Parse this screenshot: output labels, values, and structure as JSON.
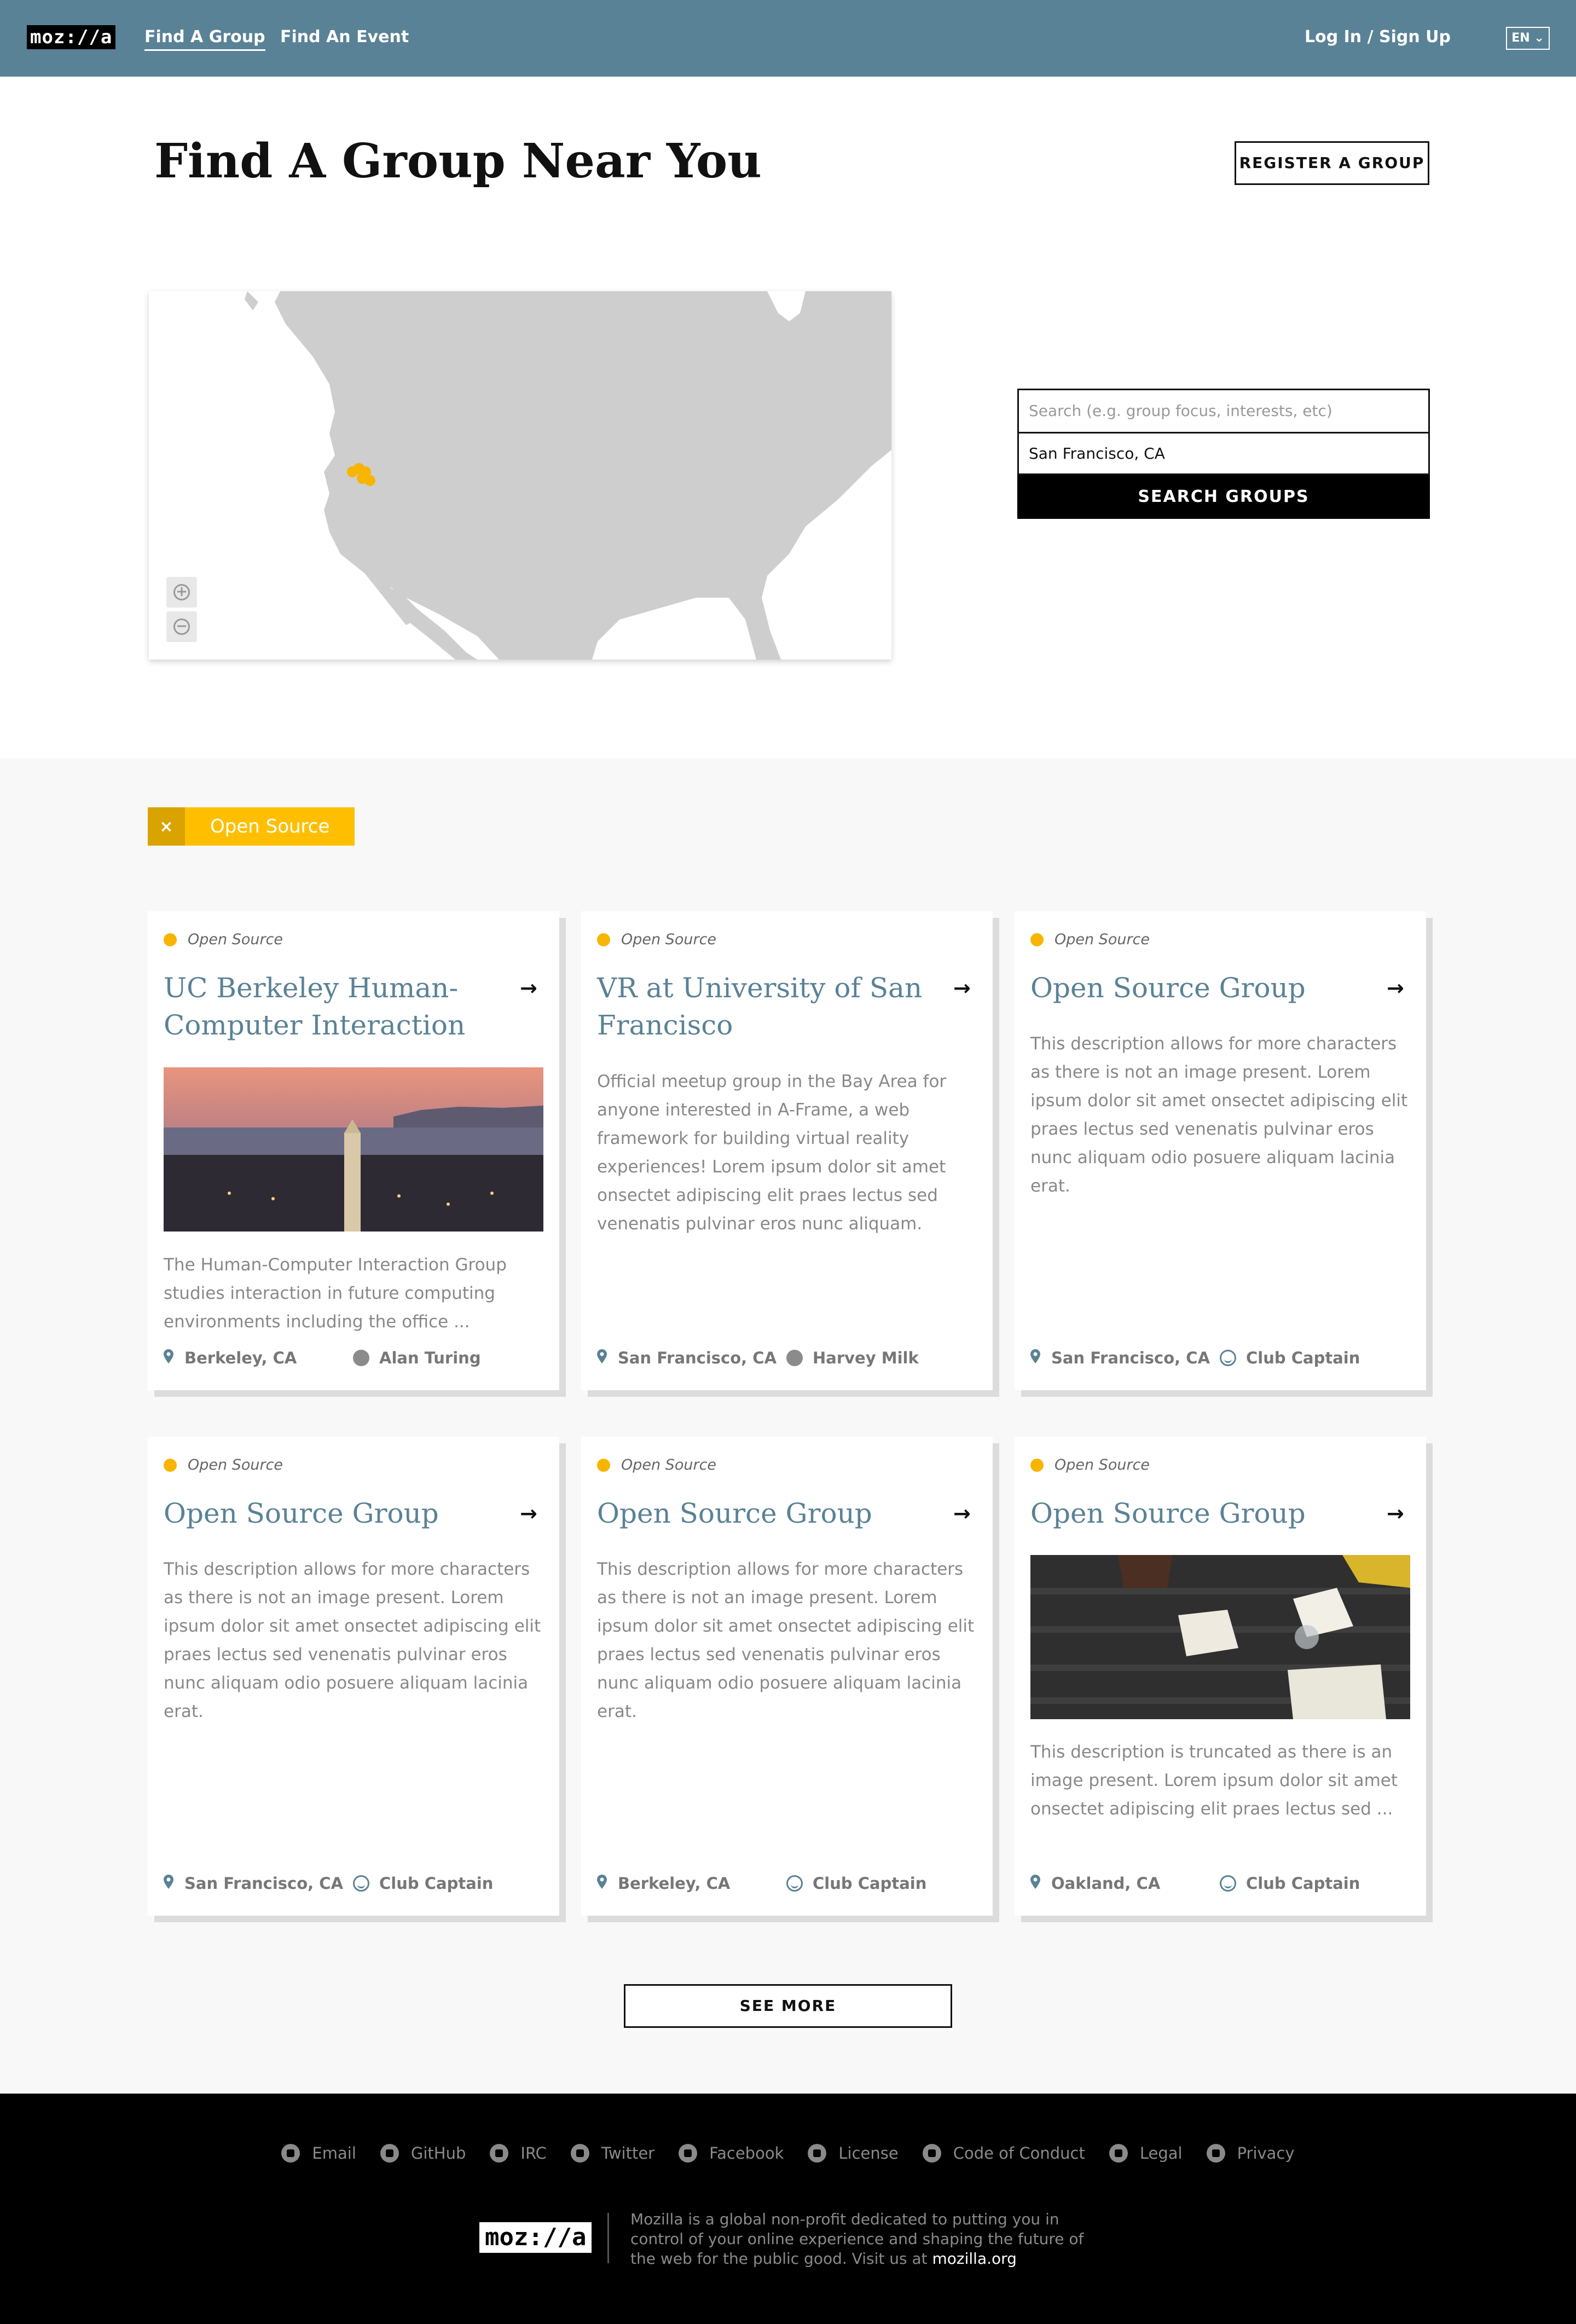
{
  "header": {
    "logo": "moz://a",
    "nav": [
      {
        "label": "Find A Group",
        "active": true
      },
      {
        "label": "Find An Event",
        "active": false
      }
    ],
    "login": "Log In / Sign Up",
    "lang": "EN"
  },
  "hero": {
    "title": "Find A Group Near You",
    "register_label": "REGISTER A GROUP"
  },
  "search": {
    "placeholder": "Search (e.g. group focus, interests, etc)",
    "location": "San Francisco, CA",
    "button": "SEARCH GROUPS"
  },
  "filter": {
    "label": "Open Source",
    "remove": "×"
  },
  "cards": [
    {
      "tag": "Open Source",
      "title": "UC Berkeley Human-Computer Interaction",
      "description": "The Human-Computer Interaction Group studies interaction in future computing environments including the office ...",
      "location": "Berkeley, CA",
      "user": "Alan Turing",
      "has_image": true
    },
    {
      "tag": "Open Source",
      "title": "VR at University of San Francisco",
      "description": "Official meetup group in the Bay Area for anyone interested in A-Frame, a web framework for building virtual reality experiences! Lorem ipsum dolor sit amet onsectet adipiscing elit praes lectus sed venenatis pulvinar eros nunc aliquam.",
      "location": "San Francisco, CA",
      "user": "Harvey Milk",
      "has_image": false
    },
    {
      "tag": "Open Source",
      "title": "Open Source Group",
      "description": "This description allows for more characters as there is not an image present. Lorem ipsum dolor sit amet onsectet adipiscing elit praes lectus sed venenatis pulvinar eros nunc aliquam odio posuere aliquam lacinia erat.",
      "location": "San Francisco, CA",
      "user": "Club Captain",
      "has_image": false
    },
    {
      "tag": "Open Source",
      "title": "Open Source Group",
      "description": "This description allows for more characters as there is not an image present. Lorem ipsum dolor sit amet onsectet adipiscing elit praes lectus sed venenatis pulvinar eros nunc aliquam odio posuere aliquam lacinia erat.",
      "location": "San Francisco, CA",
      "user": "Club Captain",
      "has_image": false
    },
    {
      "tag": "Open Source",
      "title": "Open Source Group",
      "description": "This description allows for more characters as there is not an image present. Lorem ipsum dolor sit amet onsectet adipiscing elit praes lectus sed venenatis pulvinar eros nunc aliquam odio posuere aliquam lacinia erat.",
      "location": "Berkeley, CA",
      "user": "Club Captain",
      "has_image": false
    },
    {
      "tag": "Open Source",
      "title": "Open Source Group",
      "description": "This description is truncated as there is an image present. Lorem ipsum dolor sit amet onsectet adipiscing elit praes lectus sed ...",
      "location": "Oakland, CA",
      "user": "Club Captain",
      "has_image": true
    }
  ],
  "see_more": "SEE MORE",
  "footer": {
    "links": [
      {
        "label": "Email",
        "icon": "email-icon"
      },
      {
        "label": "GitHub",
        "icon": "github-icon"
      },
      {
        "label": "IRC",
        "icon": "irc-icon"
      },
      {
        "label": "Twitter",
        "icon": "twitter-icon"
      },
      {
        "label": "Facebook",
        "icon": "facebook-icon"
      },
      {
        "label": "License",
        "icon": "license-icon"
      },
      {
        "label": "Code of Conduct",
        "icon": "code-of-conduct-icon"
      },
      {
        "label": "Legal",
        "icon": "legal-icon"
      },
      {
        "label": "Privacy",
        "icon": "privacy-icon"
      }
    ],
    "logo": "moz://a",
    "text": "Mozilla is a global non-profit dedicated to putting you in control of your online experience and shaping the future of the web for the public good. Visit us at",
    "link": "mozilla.org"
  },
  "colors": {
    "header": "#5a8296",
    "accent": "#ffbf00",
    "dot": "#f7b500",
    "title_text": "#5a8296"
  }
}
